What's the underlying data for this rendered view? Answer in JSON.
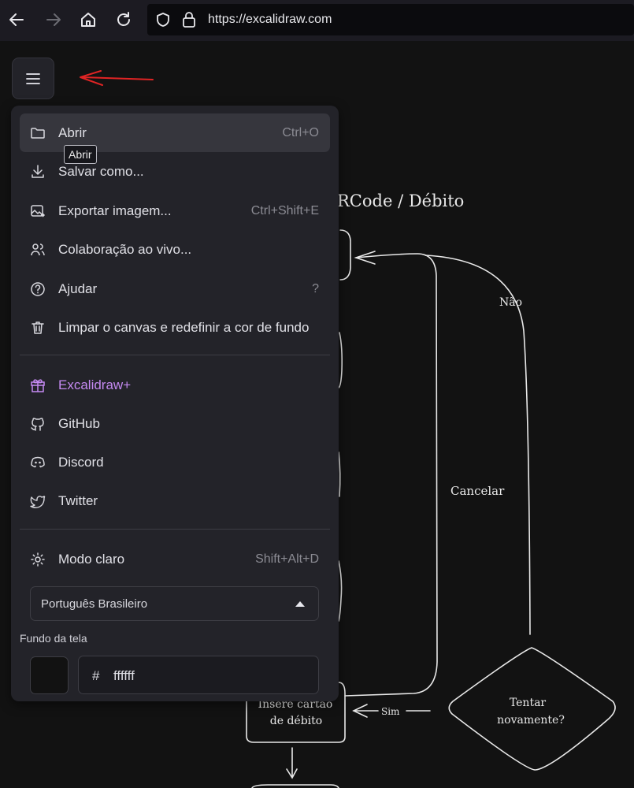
{
  "browser": {
    "url": "https://excalidraw.com",
    "icons": [
      "back-arrow-icon",
      "forward-arrow-icon",
      "home-icon",
      "reload-icon",
      "shield-icon",
      "lock-icon"
    ]
  },
  "canvas": {
    "title_fragment": "RCode / Débito",
    "label_nao": "Não",
    "label_cancelar": "Cancelar",
    "label_sim": "Sim",
    "decision_text_1": "Tentar",
    "decision_text_2": "novamente?",
    "box_text_1": "Insere cartão",
    "box_text_2": "de débito"
  },
  "menu": {
    "items": [
      {
        "label": "Abrir",
        "shortcut": "Ctrl+O",
        "icon": "folder-icon"
      },
      {
        "label": "Salvar como...",
        "shortcut": "",
        "icon": "download-icon"
      },
      {
        "label": "Exportar imagem...",
        "shortcut": "Ctrl+Shift+E",
        "icon": "export-image-icon"
      },
      {
        "label": "Colaboração ao vivo...",
        "shortcut": "",
        "icon": "users-icon"
      },
      {
        "label": "Ajudar",
        "shortcut": "?",
        "icon": "help-icon"
      },
      {
        "label": "Limpar o canvas e redefinir a cor de fundo",
        "shortcut": "",
        "icon": "trash-icon"
      }
    ],
    "links": [
      {
        "label": "Excalidraw+",
        "icon": "gift-icon"
      },
      {
        "label": "GitHub",
        "icon": "github-icon"
      },
      {
        "label": "Discord",
        "icon": "discord-icon"
      },
      {
        "label": "Twitter",
        "icon": "twitter-icon"
      }
    ],
    "theme": {
      "label": "Modo claro",
      "shortcut": "Shift+Alt+D",
      "icon": "sun-icon"
    },
    "language": {
      "selected": "Português Brasileiro"
    },
    "background": {
      "label": "Fundo da tela",
      "hash": "#",
      "hex_value": "ffffff"
    },
    "tooltip": "Abrir"
  },
  "colors": {
    "accent_plus": "#c58af2",
    "annotation_red": "#e02424",
    "menu_bg": "#232329",
    "canvas_bg": "#121212"
  }
}
